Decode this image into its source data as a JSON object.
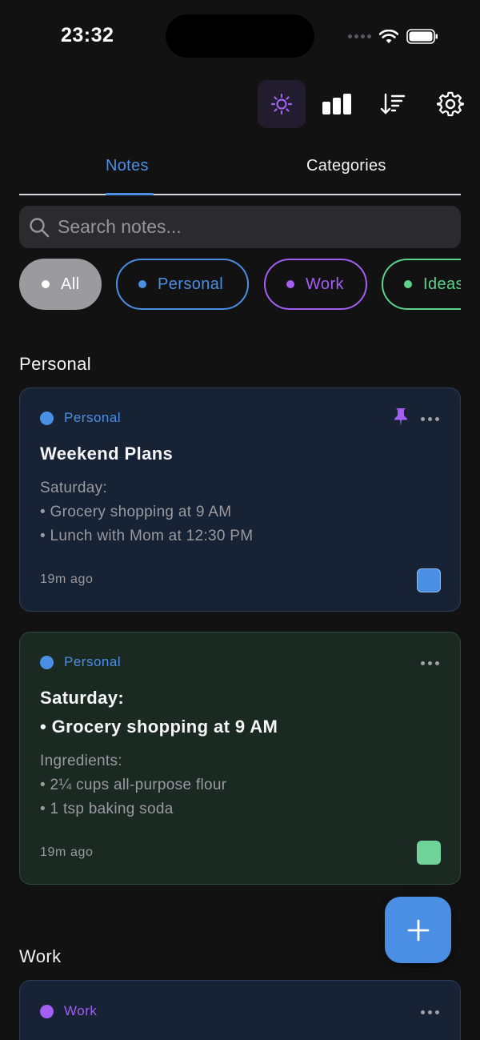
{
  "status_bar": {
    "time": "23:32"
  },
  "tabs": {
    "notes": "Notes",
    "categories": "Categories"
  },
  "search": {
    "placeholder": "Search notes..."
  },
  "chips": [
    "All",
    "Personal",
    "Work",
    "Ideas"
  ],
  "sections": [
    {
      "title": "Personal",
      "cards": [
        {
          "category": "Personal",
          "title": "Weekend Plans",
          "body": [
            "Saturday:",
            "• Grocery shopping at 9 AM",
            "• Lunch with Mom at 12:30 PM"
          ],
          "time": "19m ago",
          "pinned": true,
          "color": "#4a8fe4"
        },
        {
          "category": "Personal",
          "title": [
            "Saturday:",
            "• Grocery shopping at 9 AM"
          ],
          "body": [
            "Ingredients:",
            "• 2¼ cups all-purpose flour",
            "• 1 tsp baking soda"
          ],
          "time": "19m ago",
          "pinned": false,
          "color": "#6fd39a"
        }
      ]
    },
    {
      "title": "Work",
      "cards": [
        {
          "category": "Work"
        }
      ]
    }
  ],
  "colors": {
    "accent": "#4a8fe4",
    "personal": "#4a8fe4",
    "work": "#a25ff1",
    "ideas": "#5dd28a",
    "background": "#121212"
  },
  "icons": [
    "brightness-icon",
    "bar-chart-icon",
    "sort-icon",
    "settings-icon",
    "search-icon",
    "pin-icon",
    "more-icon",
    "plus-icon"
  ]
}
